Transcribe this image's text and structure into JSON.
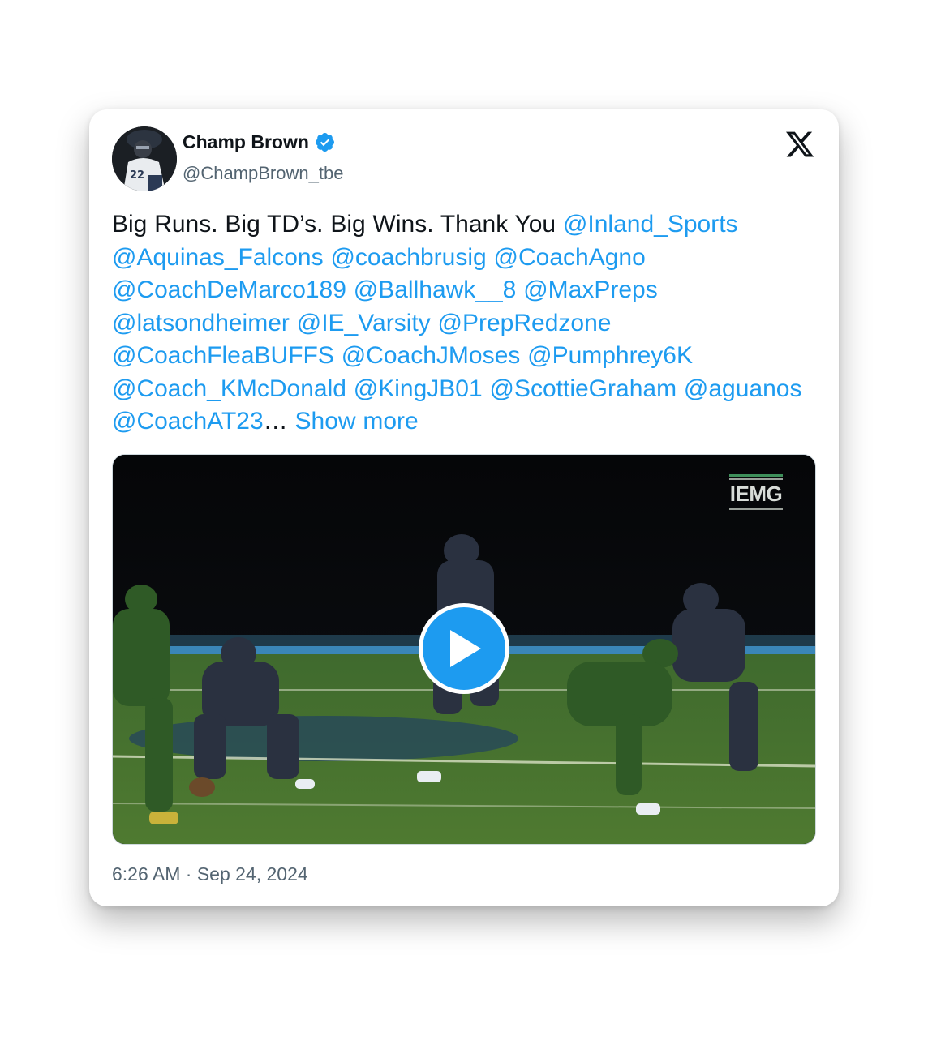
{
  "author": {
    "name": "Champ Brown",
    "handle": "@ChampBrown_tbe",
    "verified": true
  },
  "tweet": {
    "text_prefix": "Big Runs. Big TD’s. Big Wins. Thank You ",
    "mentions": [
      "@Inland_Sports",
      "@Aquinas_Falcons",
      "@coachbrusig",
      "@CoachAgno",
      "@CoachDeMarco189",
      "@Ballhawk__8",
      "@MaxPreps",
      "@latsondheimer",
      "@IE_Varsity",
      "@PrepRedzone",
      "@CoachFleaBUFFS",
      "@CoachJMoses",
      "@Pumphrey6K",
      "@Coach_KMcDonald",
      "@KingJB01",
      "@ScottieGraham",
      "@aguanos",
      "@CoachAT23"
    ],
    "ellipsis": "…",
    "show_more": "Show more"
  },
  "media": {
    "watermark": "IEMG",
    "play_icon": "play-icon"
  },
  "timestamp": "6:26 AM · Sep 24, 2024",
  "colors": {
    "accent": "#1d9bf0",
    "text": "#0f1419",
    "secondary": "#536471"
  }
}
